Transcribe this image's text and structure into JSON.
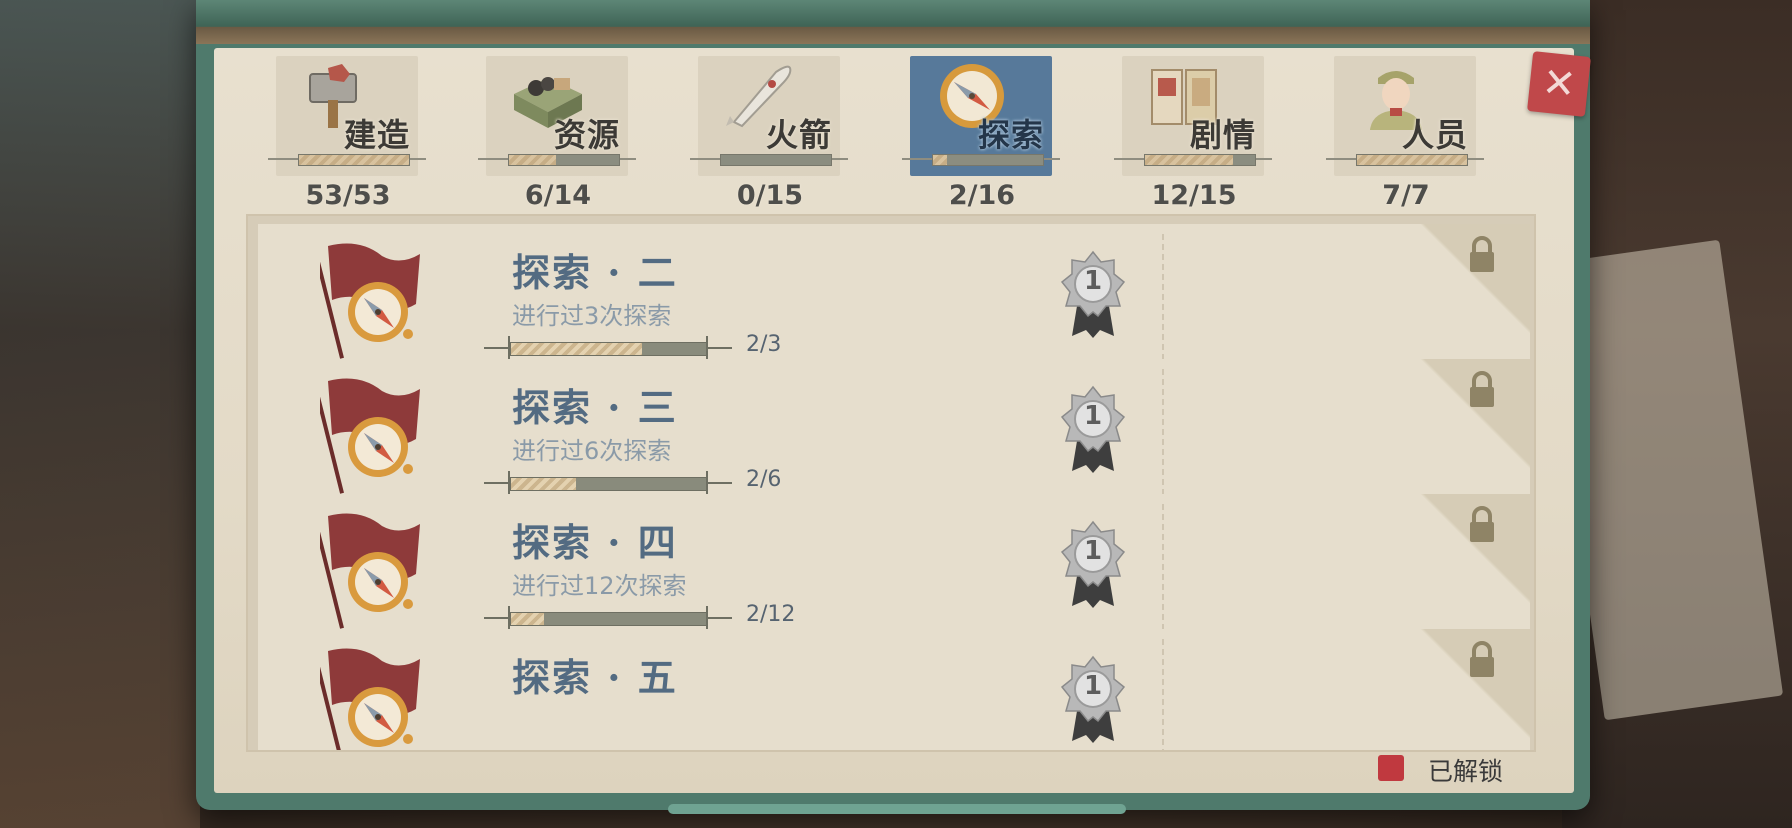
{
  "close": {
    "glyph": "✕"
  },
  "tabs": [
    {
      "label": "建造",
      "count": "53/53",
      "progress": 1.0,
      "icon": "hammer-icon",
      "active": false
    },
    {
      "label": "资源",
      "count": "6/14",
      "progress": 0.43,
      "icon": "resource-crate-icon",
      "active": false
    },
    {
      "label": "火箭",
      "count": "0/15",
      "progress": 0.0,
      "icon": "rocket-icon",
      "active": false
    },
    {
      "label": "探索",
      "count": "2/16",
      "progress": 0.13,
      "icon": "compass-icon",
      "active": true
    },
    {
      "label": "剧情",
      "count": "12/15",
      "progress": 0.8,
      "icon": "storybook-icon",
      "active": false
    },
    {
      "label": "人员",
      "count": "7/7",
      "progress": 1.0,
      "icon": "soldier-icon",
      "active": false
    }
  ],
  "achievements": [
    {
      "title": "探索 · 二",
      "desc": "进行过3次探索",
      "progress_text": "2/3",
      "progress": 0.667,
      "medal": "1",
      "locked": true
    },
    {
      "title": "探索 · 三",
      "desc": "进行过6次探索",
      "progress_text": "2/6",
      "progress": 0.333,
      "medal": "1",
      "locked": true
    },
    {
      "title": "探索 · 四",
      "desc": "进行过12次探索",
      "progress_text": "2/12",
      "progress": 0.167,
      "medal": "1",
      "locked": true
    },
    {
      "title": "探索 · 五",
      "desc": "",
      "progress_text": "",
      "progress": 0,
      "medal": "1",
      "locked": true
    }
  ],
  "legend": {
    "label": "已解锁",
    "color": "#c0393f"
  },
  "colors": {
    "accent_blue": "#57799a",
    "title_blue": "#536b82",
    "board_green": "#4f7a6c"
  }
}
